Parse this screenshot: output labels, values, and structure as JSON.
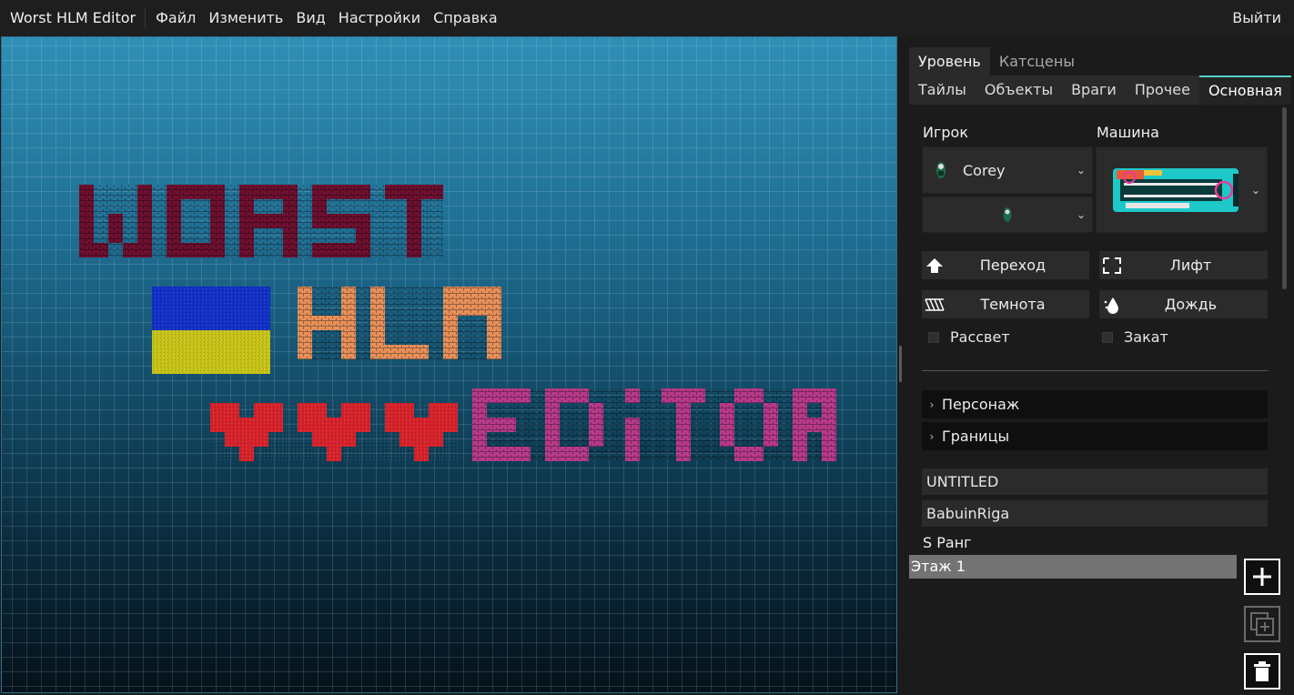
{
  "app_title": "Worst HLM Editor",
  "menu": [
    "Файл",
    "Изменить",
    "Вид",
    "Настройки",
    "Справка"
  ],
  "exit_label": "Выйти",
  "canvas": {
    "words": [
      "WORST",
      "HLM",
      "EDITOR"
    ],
    "colors": {
      "worst": "#6e1030",
      "hlm": "#e8905a",
      "editor": "#b83a8a",
      "heart": "#d8222a",
      "flag_blue": "#1230c8",
      "flag_yellow": "#c8c418"
    }
  },
  "tabs_top": [
    "Уровень",
    "Катсцены"
  ],
  "tabs_sub": [
    "Тайлы",
    "Объекты",
    "Враги",
    "Прочее",
    "Основная"
  ],
  "player_label": "Игрок",
  "car_label": "Машина",
  "player_value": "Corey",
  "buttons": {
    "transition": "Переход",
    "lift": "Лифт",
    "darkness": "Темнота",
    "rain": "Дождь"
  },
  "checkboxes": {
    "dawn": "Рассвет",
    "sunset": "Закат"
  },
  "sections": [
    "Персонаж",
    "Границы"
  ],
  "fields": {
    "level_name": "UNTITLED",
    "author": "BabuinRiga"
  },
  "rank_label": "S Ранг",
  "floors": [
    "Этаж 1"
  ],
  "accent_color": "#4fd3c8"
}
